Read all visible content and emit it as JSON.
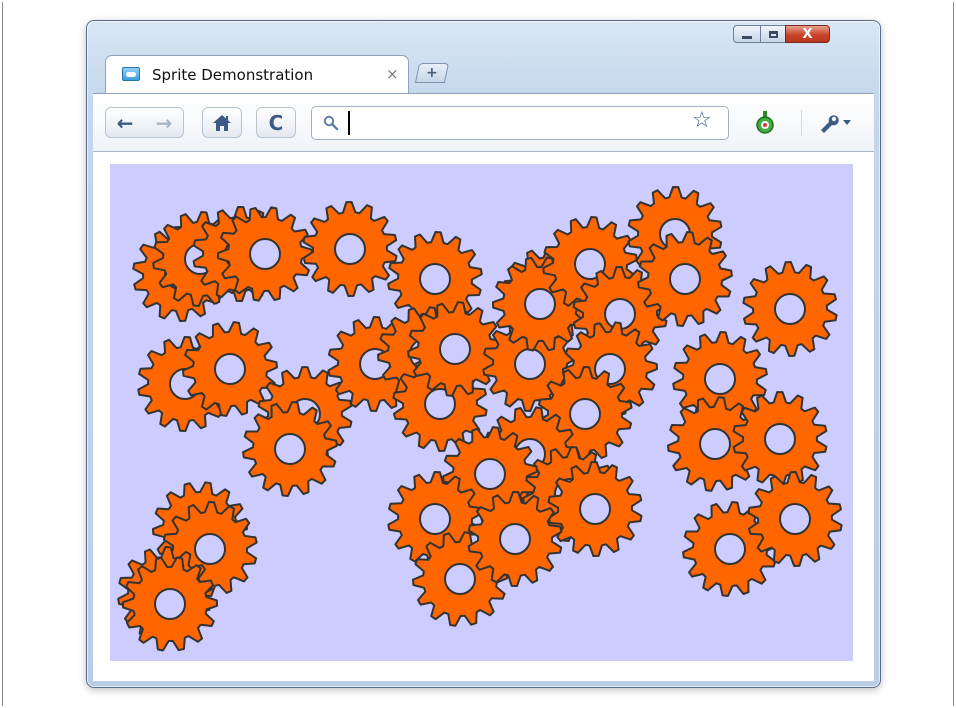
{
  "window": {
    "controls": {
      "minimize_icon": "minimize-icon",
      "maximize_icon": "maximize-icon",
      "close_icon": "close-icon",
      "close_glyph": "X"
    }
  },
  "tab": {
    "title": "Sprite Demonstration",
    "close_glyph": "×",
    "new_tab_glyph": "+"
  },
  "toolbar": {
    "back_glyph": "←",
    "forward_glyph": "→",
    "reload_glyph": "C",
    "omnibox_value": "",
    "star_glyph": "☆"
  },
  "content": {
    "background_color": "#ccccff",
    "sprite_color": "#ff6600",
    "sprite_stroke": "#333333",
    "sprite_icon": "gear-icon"
  }
}
